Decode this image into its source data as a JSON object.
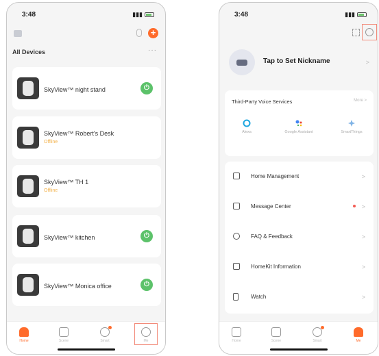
{
  "left": {
    "status_time": "3:48",
    "section_title": "All Devices",
    "more": "···",
    "add_label": "+",
    "devices": [
      {
        "name": "SkyView™ night stand",
        "status": "",
        "powered": true
      },
      {
        "name": "SkyView™ Robert's Desk",
        "status": "Offline",
        "powered": false
      },
      {
        "name": "SkyView™ TH 1",
        "status": "Offline",
        "powered": false
      },
      {
        "name": "SkyView™ kitchen",
        "status": "",
        "powered": true
      },
      {
        "name": "SkyView™ Monica office",
        "status": "",
        "powered": true
      }
    ],
    "power_glyph": "⏻",
    "tabs": [
      {
        "label": "Home",
        "active": true
      },
      {
        "label": "Scene",
        "active": false
      },
      {
        "label": "Smart",
        "active": false
      },
      {
        "label": "Me",
        "active": false
      }
    ]
  },
  "right": {
    "status_time": "3:48",
    "nickname": "Tap to Set Nickname",
    "voice_title": "Third-Party Voice Services",
    "voice_more": "More >",
    "services": [
      {
        "label": "Alexa",
        "color": "#1fa7e0"
      },
      {
        "label": "Google Assistant",
        "color": "#4285f4"
      },
      {
        "label": "SmartThings",
        "color": "#7fb3e6"
      }
    ],
    "menu": [
      {
        "label": "Home Management",
        "badge": false
      },
      {
        "label": "Message Center",
        "badge": true
      },
      {
        "label": "FAQ & Feedback",
        "badge": false
      },
      {
        "label": "HomeKit Information",
        "badge": false
      },
      {
        "label": "Watch",
        "badge": false
      }
    ],
    "chevron": ">",
    "tabs": [
      {
        "label": "Home",
        "active": false
      },
      {
        "label": "Scene",
        "active": false
      },
      {
        "label": "Smart",
        "active": false
      },
      {
        "label": "Me",
        "active": true
      }
    ]
  },
  "colors": {
    "accent": "#ff6b2b",
    "power_green": "#5cc26a",
    "offline": "#f3b24c",
    "highlight": "#f28b7a"
  },
  "icons": [
    "home-switch-icon",
    "microphone-icon",
    "add-icon",
    "power-icon",
    "scan-icon",
    "settings-icon",
    "alexa-icon",
    "google-assistant-icon",
    "smartthings-icon",
    "home-icon",
    "message-icon",
    "faq-icon",
    "homekit-icon",
    "watch-icon"
  ]
}
